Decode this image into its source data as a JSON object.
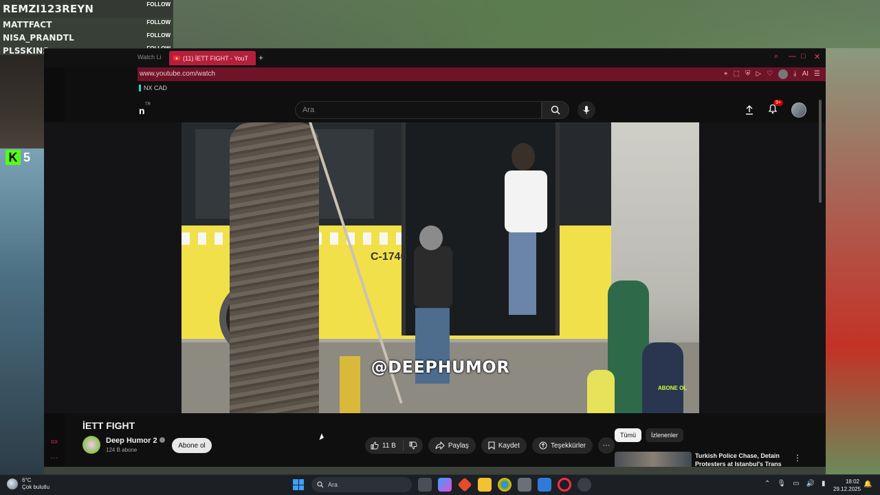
{
  "followers": [
    {
      "name": "REMZI123REYN",
      "action": "FOLLOW"
    },
    {
      "name": "MATTFACT",
      "action": "FOLLOW"
    },
    {
      "name": "NISA_PRANDTL",
      "action": "FOLLOW"
    },
    {
      "name": "PLSSKINS",
      "action": "FOLLOW"
    }
  ],
  "kick": {
    "letter": "K",
    "count": "5"
  },
  "browser": {
    "prev_tab": "Watch Li",
    "active_tab": "(11) İETT FIGHT - YouT",
    "new_tab": "+",
    "url": "www.youtube.com/watch",
    "ai_label": "AI",
    "bookmark": "NX CAD"
  },
  "sidepanel": {
    "bottom_label": "GX",
    "more": "···"
  },
  "youtube": {
    "logo_fragment": "n",
    "country": "TR",
    "search_placeholder": "Ara",
    "notif_count": "9+",
    "video": {
      "watermark": "@DEEPHUMOR",
      "bus_number": "C-1740",
      "corner_logo": "ABONE OL"
    },
    "title": "İETT FIGHT",
    "channel": {
      "name": "Deep Humor 2",
      "subscribers": "124 B abone"
    },
    "subscribe": "Abone ol",
    "likes": "11 B",
    "share": "Paylaş",
    "save": "Kaydet",
    "thanks": "Teşekkürler",
    "more": "···",
    "chips": [
      "Tümü",
      "İzlenenler"
    ],
    "recommendation": {
      "title": "Turkish Police Chase, Detain Protesters at Istanbul's Trans"
    }
  },
  "taskbar": {
    "temperature": "6°C",
    "weather": "Çok bulutlu",
    "search": "Ara",
    "time": "18:02",
    "date": "29.12.2025"
  }
}
